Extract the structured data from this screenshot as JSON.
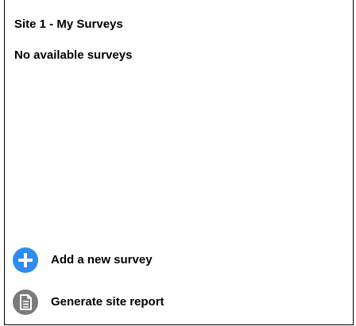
{
  "header": {
    "title": "Site 1 - My Surveys"
  },
  "main": {
    "empty_message": "No available surveys"
  },
  "actions": {
    "add_survey": {
      "label": "Add a new survey",
      "icon": "plus-circle-icon",
      "color": "#2e8bef"
    },
    "generate_report": {
      "label": "Generate site report",
      "icon": "document-icon",
      "color": "#7a7a7a"
    }
  }
}
